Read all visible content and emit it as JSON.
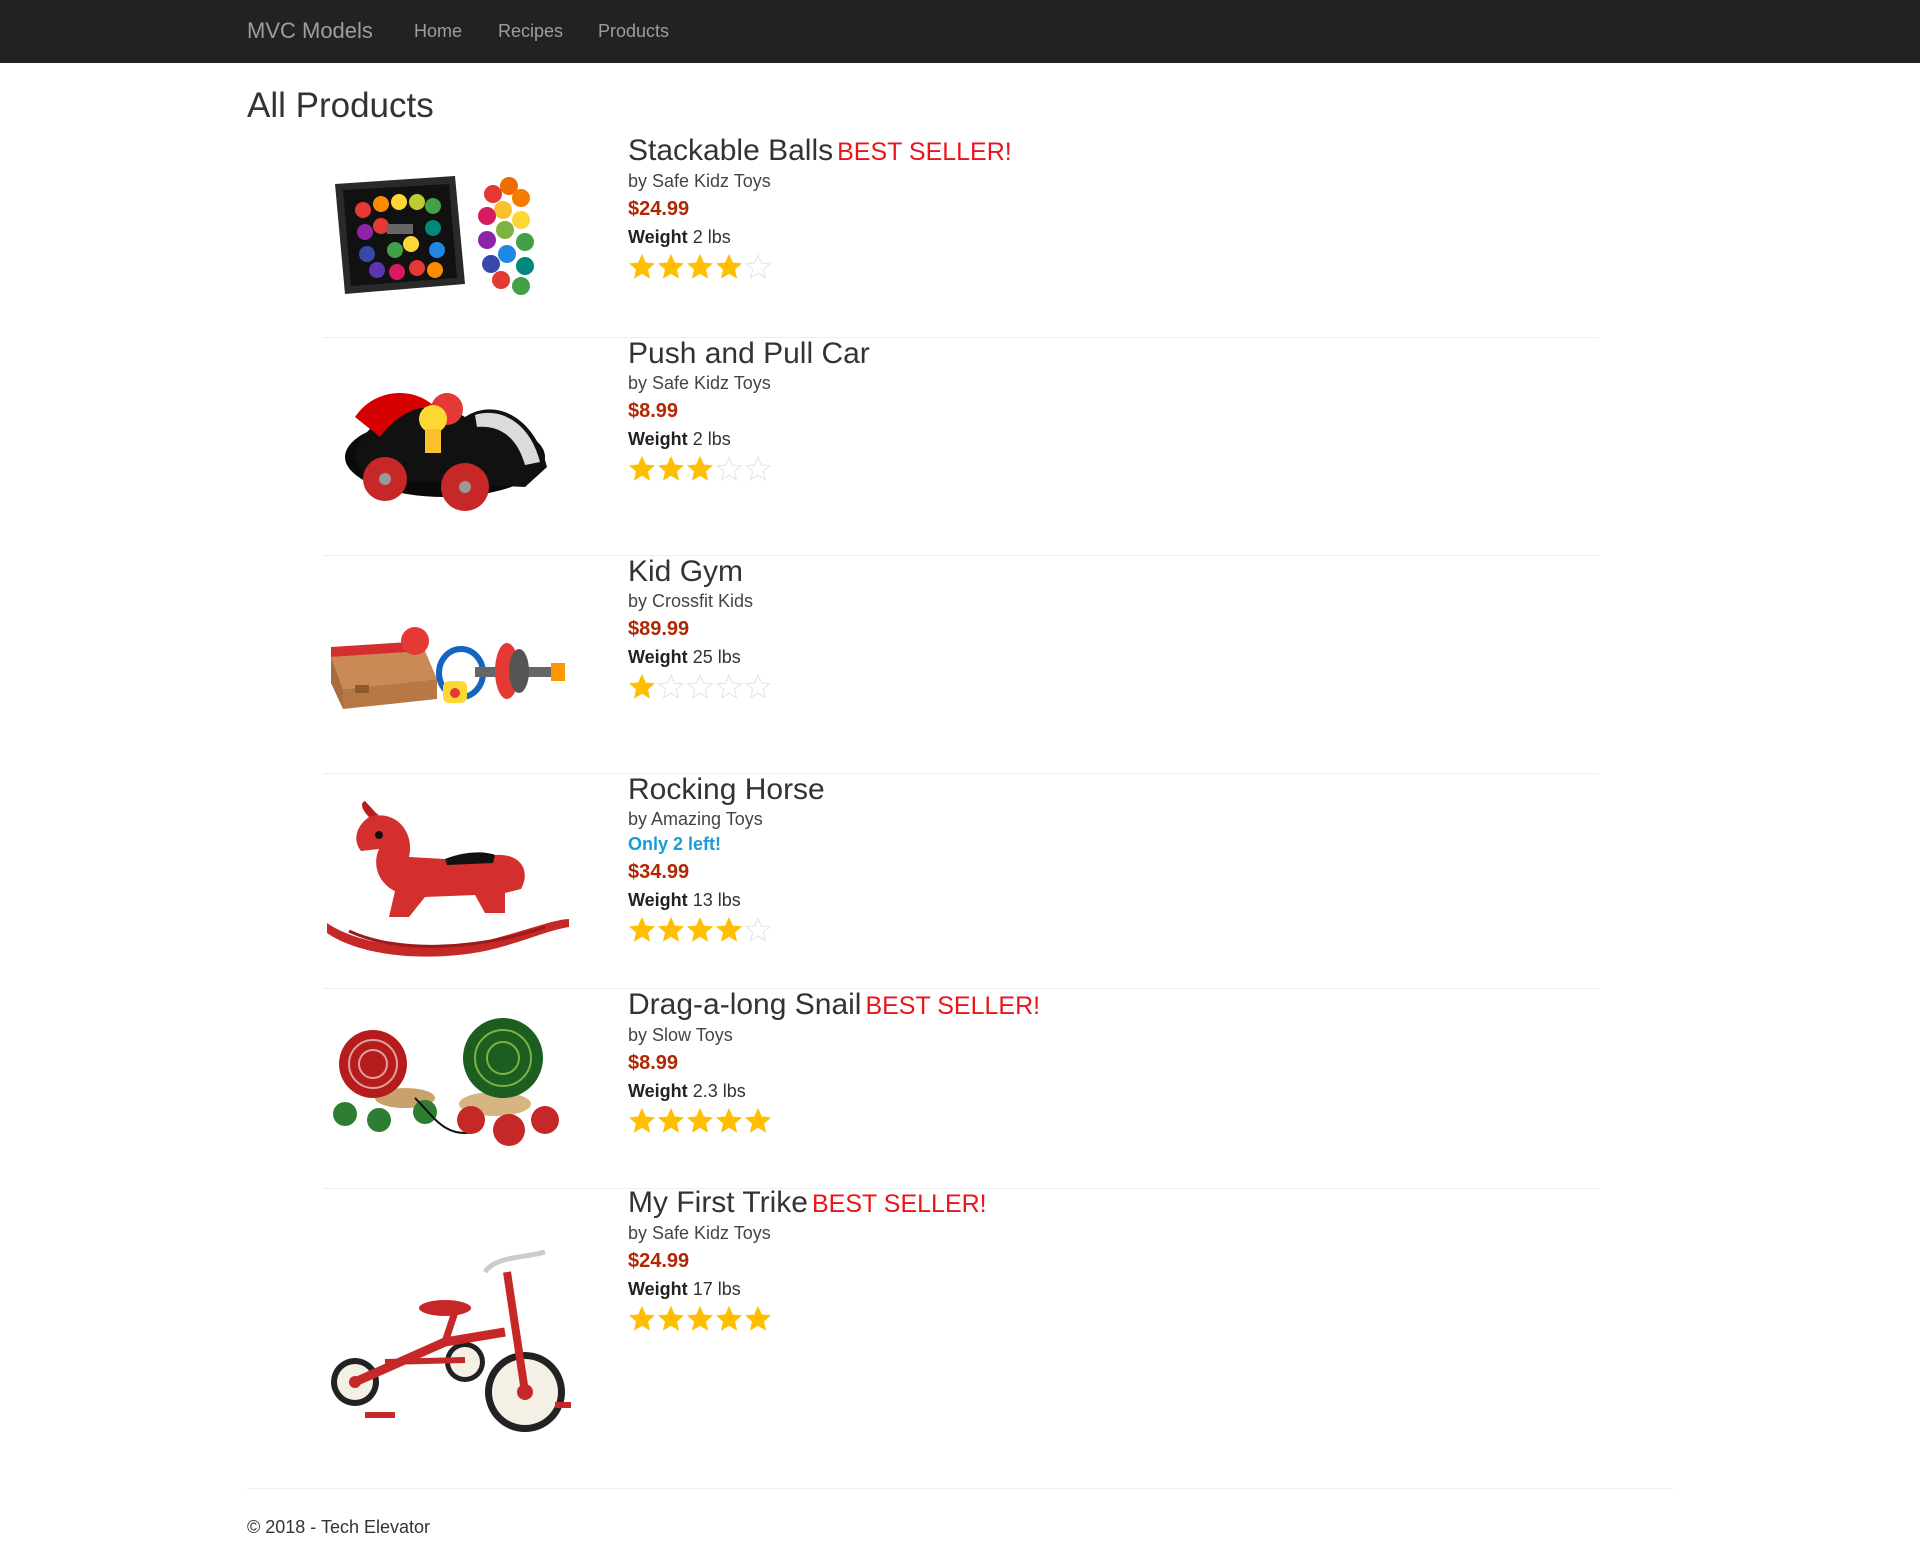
{
  "nav": {
    "brand": "MVC Models",
    "links": [
      "Home",
      "Recipes",
      "Products"
    ]
  },
  "page": {
    "title": "All Products"
  },
  "products": [
    {
      "name": "Stackable Balls",
      "badge": "BEST SELLER!",
      "maker": "by Safe Kidz Toys",
      "stock": "",
      "price": "$24.99",
      "weight_label": "Weight",
      "weight": "2 lbs",
      "rating": 4,
      "image": "stackable-balls-image"
    },
    {
      "name": "Push and Pull Car",
      "badge": "",
      "maker": "by Safe Kidz Toys",
      "stock": "",
      "price": "$8.99",
      "weight_label": "Weight",
      "weight": "2 lbs",
      "rating": 3,
      "image": "toy-car-image"
    },
    {
      "name": "Kid Gym",
      "badge": "",
      "maker": "by Crossfit Kids",
      "stock": "",
      "price": "$89.99",
      "weight_label": "Weight",
      "weight": "25 lbs",
      "rating": 1,
      "image": "kid-gym-image"
    },
    {
      "name": "Rocking Horse",
      "badge": "",
      "maker": "by Amazing Toys",
      "stock": "Only 2 left!",
      "price": "$34.99",
      "weight_label": "Weight",
      "weight": "13 lbs",
      "rating": 4,
      "image": "rocking-horse-image"
    },
    {
      "name": "Drag-a-long Snail",
      "badge": "BEST SELLER!",
      "maker": "by Slow Toys",
      "stock": "",
      "price": "$8.99",
      "weight_label": "Weight",
      "weight": "2.3 lbs",
      "rating": 5,
      "image": "snail-toy-image"
    },
    {
      "name": "My First Trike",
      "badge": "BEST SELLER!",
      "maker": "by Safe Kidz Toys",
      "stock": "",
      "price": "$24.99",
      "weight_label": "Weight",
      "weight": "17 lbs",
      "rating": 5,
      "image": "tricycle-image"
    }
  ],
  "rating_max": 5,
  "colors": {
    "star_filled": "#ffbf00",
    "star_empty": "#e6e6e6",
    "best_seller": "#e8161b",
    "price": "#b12704",
    "low_stock": "#1a9bd7",
    "navbar": "#222222"
  },
  "footer": {
    "text": "© 2018 - Tech Elevator"
  }
}
